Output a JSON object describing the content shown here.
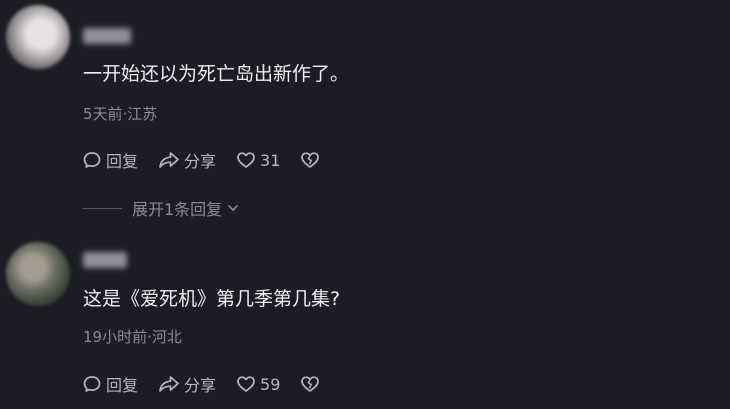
{
  "comments": [
    {
      "username": "",
      "text": "一开始还以为死亡岛出新作了。",
      "meta": "5天前·江苏",
      "reply_label": "回复",
      "share_label": "分享",
      "like_count": "31"
    },
    {
      "username": "",
      "text": "这是《爱死机》第几季第几集?",
      "meta": "19小时前·河北",
      "reply_label": "回复",
      "share_label": "分享",
      "like_count": "59"
    }
  ],
  "expand_replies": {
    "label": "展开1条回复"
  },
  "icons": {
    "reply": "comment-bubble-icon",
    "share": "share-arrow-icon",
    "like": "heart-icon",
    "dislike": "broken-heart-icon",
    "expand": "chevron-down-icon"
  }
}
